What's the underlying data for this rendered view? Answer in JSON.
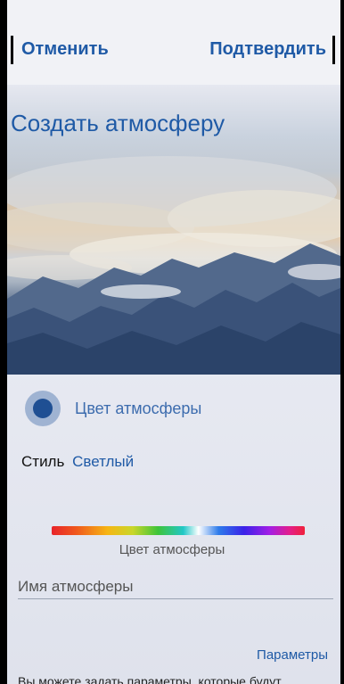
{
  "header": {
    "cancel_label": "Отменить",
    "confirm_label": "Подтвердить"
  },
  "hero": {
    "title": "Создать атмосферу"
  },
  "color": {
    "label": "Цвет атмосферы",
    "swatch_color": "#1f4f93"
  },
  "style": {
    "key": "Стиль",
    "value": "Светлый"
  },
  "spectrum": {
    "label": "Цвет атмосферы"
  },
  "name_field": {
    "placeholder": "Имя атмосферы",
    "value": ""
  },
  "params": {
    "link_label": "Параметры",
    "hint": "Вы можете задать параметры, которые будут"
  },
  "colors": {
    "accent": "#1f5aa6"
  }
}
